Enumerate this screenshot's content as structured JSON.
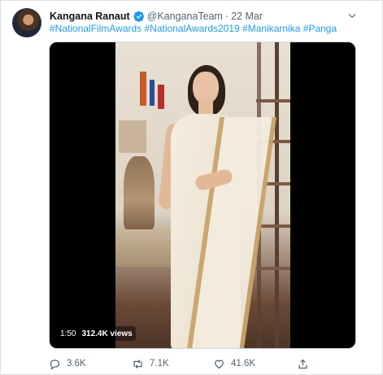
{
  "tweet": {
    "author_name": "Kangana Ranaut",
    "handle": "@KanganaTeam",
    "separator": "·",
    "date": "22 Mar",
    "hashtags": [
      "#NationalFilmAwards",
      "#NationalAwards2019",
      "#Manikarnika",
      "#Panga"
    ],
    "verified": true
  },
  "media": {
    "duration": "1:50",
    "views": "312.4K views"
  },
  "actions": {
    "replies": "3.6K",
    "retweets": "7.1K",
    "likes": "41.6K"
  },
  "icons": {
    "verified": "verified-badge-icon",
    "more": "chevron-down-icon",
    "reply": "reply-icon",
    "retweet": "retweet-icon",
    "like": "heart-icon",
    "share": "share-icon"
  },
  "colors": {
    "link": "#1d9bf0",
    "muted": "#536471",
    "verified": "#1d9bf0"
  }
}
